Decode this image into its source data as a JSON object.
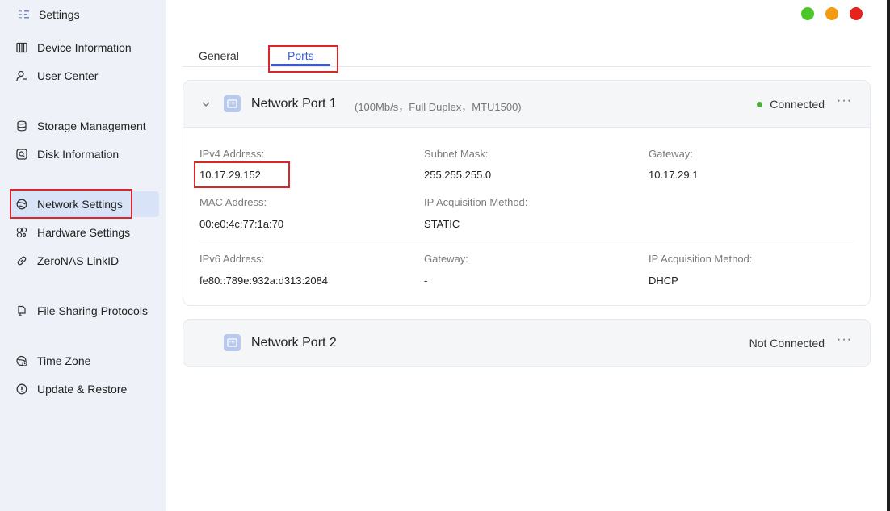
{
  "app": {
    "title": "Settings",
    "logo": "settings-logo-icon"
  },
  "window_controls": [
    {
      "name": "maximize",
      "color": "#4cc628"
    },
    {
      "name": "minimize",
      "color": "#f39a12"
    },
    {
      "name": "close",
      "color": "#e5221b"
    }
  ],
  "sidebar": {
    "items": [
      {
        "label": "Device Information",
        "icon": "device-info-icon"
      },
      {
        "label": "User Center",
        "icon": "user-icon"
      },
      {
        "label": "Storage Management",
        "icon": "storage-icon"
      },
      {
        "label": "Disk Information",
        "icon": "disk-icon"
      },
      {
        "label": "Network Settings",
        "icon": "network-globe-icon",
        "active": true
      },
      {
        "label": "Hardware Settings",
        "icon": "hardware-icon"
      },
      {
        "label": "ZeroNAS LinkID",
        "icon": "link-icon"
      },
      {
        "label": "File Sharing Protocols",
        "icon": "file-sharing-icon"
      },
      {
        "label": "Time Zone",
        "icon": "timezone-icon"
      },
      {
        "label": "Update & Restore",
        "icon": "update-icon"
      }
    ]
  },
  "tabs": [
    {
      "label": "General"
    },
    {
      "label": "Ports",
      "active": true
    }
  ],
  "ports": [
    {
      "name": "Network Port 1",
      "detail": "(100Mb/s，Full Duplex，MTU1500)",
      "status": "Connected",
      "status_color": "#4caf3a",
      "expanded": true,
      "ipv4": {
        "address_label": "IPv4 Address:",
        "address": "10.17.29.152",
        "subnet_label": "Subnet Mask:",
        "subnet": "255.255.255.0",
        "gateway_label": "Gateway:",
        "gateway": "10.17.29.1",
        "mac_label": "MAC Address:",
        "mac": "00:e0:4c:77:1a:70",
        "method_label": "IP Acquisition Method:",
        "method": "STATIC"
      },
      "ipv6": {
        "address_label": "IPv6 Address:",
        "address": "fe80::789e:932a:d313:2084",
        "gateway_label": "Gateway:",
        "gateway": "-",
        "method_label": "IP Acquisition Method:",
        "method": "DHCP"
      }
    },
    {
      "name": "Network Port 2",
      "status": "Not Connected",
      "expanded": false
    }
  ],
  "more_label": "···"
}
